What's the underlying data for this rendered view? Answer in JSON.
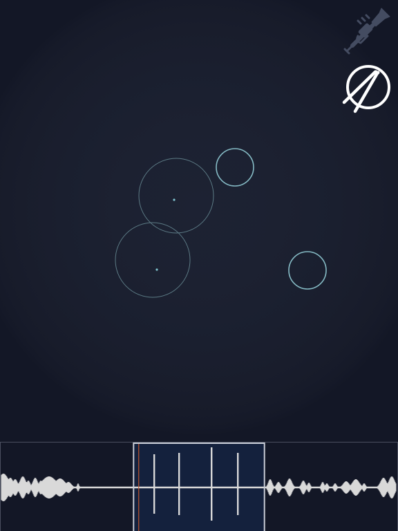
{
  "app": {
    "instruments": [
      {
        "id": "trumpet",
        "icon": "trumpet-icon",
        "active": false
      },
      {
        "id": "drums",
        "icon": "drumsticks-icon",
        "active": true
      }
    ]
  },
  "colors": {
    "background": "#131726",
    "accent": "#7fc4cf",
    "ring": "#8fb7bd",
    "waveform": "#d9d9d9",
    "selection": "#14213d",
    "playhead": "#c0562e",
    "frame": "#c8ccd6",
    "inactive_icon": "#4a5266",
    "active_icon": "#ffffff"
  },
  "stage": {
    "pads": [
      {
        "id": "pad-a",
        "kind": "large-with-dot"
      },
      {
        "id": "pad-b",
        "kind": "large-with-dot"
      },
      {
        "id": "pad-c",
        "kind": "small-ring"
      },
      {
        "id": "pad-d",
        "kind": "small-ring"
      }
    ]
  },
  "timeline": {
    "selection_start": 0.335,
    "selection_end": 0.665,
    "playhead": 0.348
  }
}
